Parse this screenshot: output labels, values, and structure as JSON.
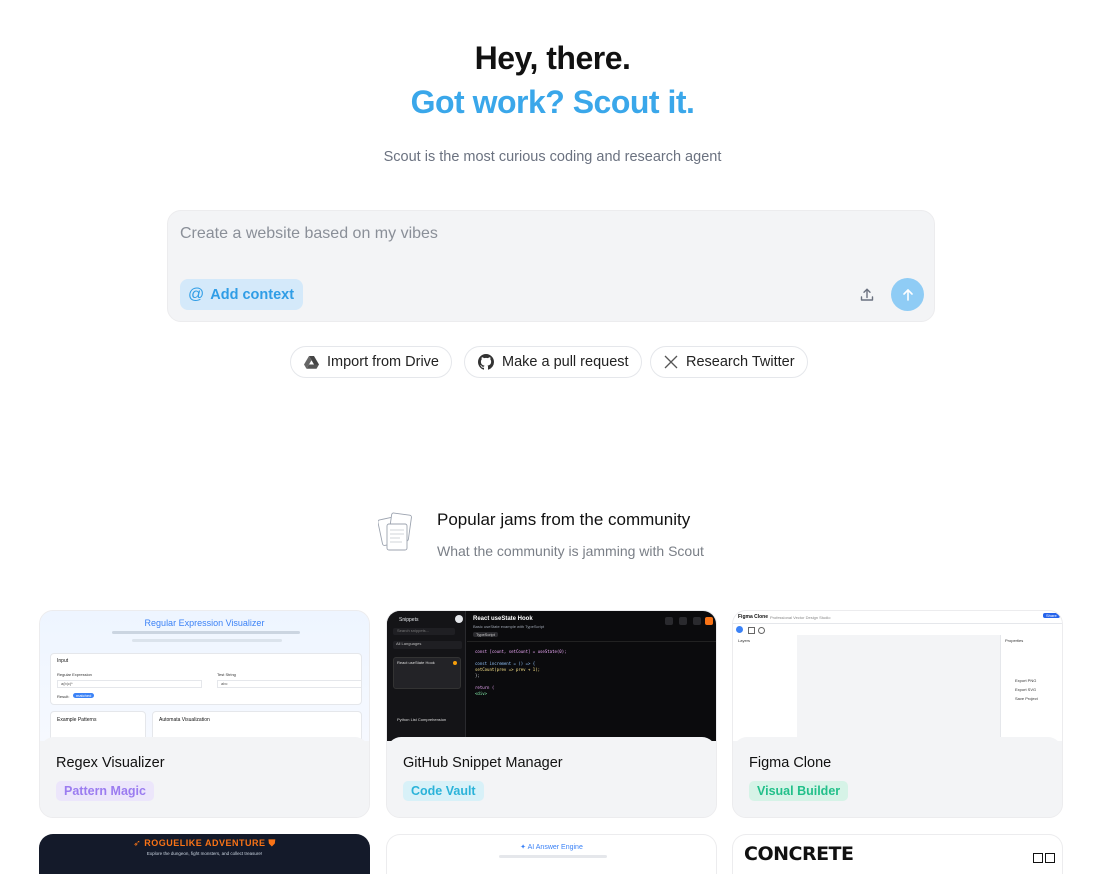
{
  "hero": {
    "title": "Hey, there.",
    "accent": "Got work? Scout it.",
    "subtitle": "Scout is the most curious coding and research agent"
  },
  "prompt": {
    "placeholder": "Create a website based on my vibes",
    "add_context_label": "Add context"
  },
  "quick_actions": [
    {
      "label": "Import from Drive",
      "icon": "google-drive-icon"
    },
    {
      "label": "Make a pull request",
      "icon": "github-icon"
    },
    {
      "label": "Research Twitter",
      "icon": "x-icon"
    }
  ],
  "community": {
    "title": "Popular jams from the community",
    "subtitle": "What the community is jamming with Scout"
  },
  "cards": [
    {
      "name": "Regex Visualizer",
      "tag": "Pattern Magic",
      "tag_color": "#9b7cf0",
      "tag_bg": "#ece6fb",
      "preview": {
        "title": "Regular Expression Visualizer",
        "input_heading": "Input",
        "regex_label": "Regular Expression",
        "regex_value": "a(b|c)*",
        "test_label": "Test String",
        "test_value": "abc",
        "result_label": "Result:",
        "result_badge": "matched",
        "patterns_heading": "Example Patterns",
        "auto_heading": "Automata Visualization"
      }
    },
    {
      "name": "GitHub Snippet Manager",
      "tag": "Code Vault",
      "tag_color": "#2bb3d9",
      "tag_bg": "#d8f1f8",
      "preview": {
        "app_name": "Snippets",
        "search_placeholder": "Search snippets...",
        "filter": "All Languages",
        "snippet_title": "React useState Hook",
        "snippet_subtitle": "Basic useState example with TypeScript",
        "lang_badge": "TypeScript",
        "item1": "React useState Hook",
        "item2": "Python List Comprehension",
        "code_line_1": "const [count, setCount] = useState(0);",
        "code_line_2": "const increment = () => {",
        "code_line_3": "  setCount(prev => prev + 1);",
        "code_line_4": "};",
        "code_line_5": "return (",
        "code_line_6": "  <div>"
      }
    },
    {
      "name": "Figma Clone",
      "tag": "Visual Builder",
      "tag_color": "#22c08a",
      "tag_bg": "#d6f3e7",
      "preview": {
        "app_name": "Figma Clone",
        "app_sub": "Professional Vector Design Studio",
        "share_label": "Share",
        "layers_label": "Layers",
        "properties_label": "Properties",
        "export_png": "Export PNG",
        "export_svg": "Export SVG",
        "save_project": "Save Project"
      }
    }
  ],
  "cards_row2": [
    {
      "title": "ROGUELIKE ADVENTURE",
      "subtitle": "Explore the dungeon, fight monsters, and collect treasure!"
    },
    {
      "title": "AI Answer Engine"
    },
    {
      "title": "CONCRETE"
    }
  ],
  "colors": {
    "accent": "#3aa7ea",
    "send_button": "#8fccf5",
    "add_context_bg": "#d4e9fa"
  }
}
